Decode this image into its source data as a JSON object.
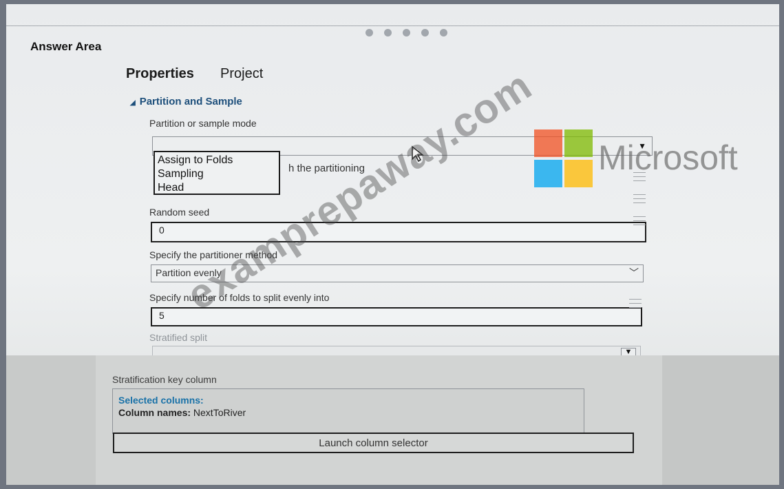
{
  "header": {
    "title": "Answer Area"
  },
  "tabs": [
    {
      "label": "Properties"
    },
    {
      "label": "Project"
    }
  ],
  "section": {
    "title": "Partition and Sample"
  },
  "partition_mode": {
    "label": "Partition or sample mode",
    "options": [
      "Assign to Folds",
      "Sampling",
      "Head"
    ],
    "partial_text": "h the partitioning"
  },
  "random_seed": {
    "label": "Random seed",
    "value": "0"
  },
  "partitioner_method": {
    "label": "Specify the partitioner method",
    "value": "Partition evenly"
  },
  "folds": {
    "label": "Specify number of folds to split evenly into",
    "value": "5"
  },
  "stratified": {
    "label": "Stratified split"
  },
  "stratification": {
    "label": "Stratification key column",
    "selected_header": "Selected columns:",
    "column_names_label": "Column names:",
    "column_names_value": "NextToRiver",
    "launch_label": "Launch column selector"
  },
  "watermark": {
    "text": "examprepaway.com",
    "brand": "Microsoft"
  },
  "colors": {
    "section_blue": "#1d4f7b",
    "selected_blue": "#1a72a8",
    "ms_red": "#f25022",
    "ms_green": "#7fba00",
    "ms_blue": "#00a4ef",
    "ms_yellow": "#ffb900"
  }
}
